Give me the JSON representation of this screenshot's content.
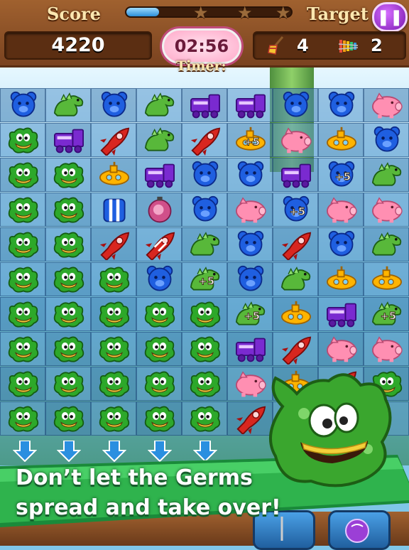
{
  "header": {
    "score_label": "Score",
    "score_value": "4220",
    "target_label": "Target",
    "timer_value": "02:56",
    "timer_label": "Timer:",
    "progress_fraction": 0.2,
    "stars": 3,
    "pause_icon": "pause-icon",
    "targets": [
      {
        "icon": "broom-icon",
        "count": "4"
      },
      {
        "icon": "xylophone-icon",
        "count": "2"
      }
    ]
  },
  "board": {
    "rows": [
      [
        "bear",
        "dino",
        "bear",
        "dino",
        "train",
        "train",
        "bear",
        "bear",
        "pig"
      ],
      [
        "germ",
        "train",
        "rocket",
        "dino",
        "rocket",
        "sub+5",
        "pig",
        "sub",
        "bear"
      ],
      [
        "germ",
        "germ",
        "sub",
        "train",
        "bear",
        "bear",
        "train",
        "bear+5",
        "dino"
      ],
      [
        "germ",
        "germ",
        "striped",
        "bomb",
        "bear",
        "pig",
        "bear+5",
        "pig",
        "pig"
      ],
      [
        "germ",
        "germ",
        "rocket",
        "rocket-striped",
        "dino",
        "bear",
        "rocket",
        "bear",
        "dino"
      ],
      [
        "germ",
        "germ",
        "germ",
        "bear",
        "dino+5",
        "bear",
        "dino",
        "sub",
        "sub"
      ],
      [
        "germ",
        "germ",
        "germ",
        "germ",
        "germ",
        "dino+5",
        "sub",
        "train",
        "dino+5"
      ],
      [
        "germ",
        "germ",
        "germ",
        "germ",
        "germ",
        "train",
        "rocket",
        "pig",
        "pig"
      ],
      [
        "germ",
        "germ",
        "germ",
        "germ",
        "germ",
        "pig",
        "sub",
        "rocket",
        "germ"
      ],
      [
        "germ",
        "germ",
        "germ",
        "germ",
        "germ",
        "rocket",
        "",
        "",
        ""
      ]
    ],
    "colors": {
      "bear": "#1f5fe0",
      "dino": "#58b83a",
      "train": "#7a2ad0",
      "rocket": "#d8261f",
      "pig": "#ff8fb2",
      "sub": "#ffb400",
      "germ": "#2da82a",
      "bomb": "#d0508a"
    },
    "bonus_label": "+5"
  },
  "banner": {
    "line1": "Don’t let the Germs",
    "line2": "spread and take over!"
  }
}
